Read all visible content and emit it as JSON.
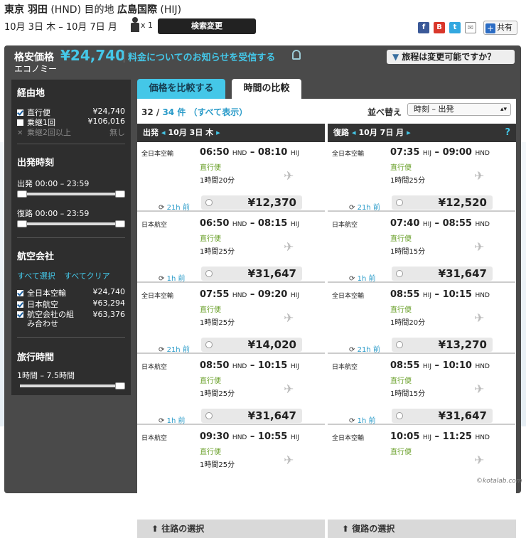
{
  "header": {
    "origin": "東京 羽田",
    "origin_code": "(HND)",
    "dest_label": "目的地",
    "dest": "広島国際",
    "dest_code": "(HIJ)",
    "dates": "10月 3日 木 – 10月 7日 月",
    "passengers": "x 1",
    "search_change": "検索変更",
    "share_label": "共有"
  },
  "price_bar": {
    "label": "格安価格",
    "price": "¥24,740",
    "notify": "料金についてのお知らせを受信する",
    "cabin": "エコノミー",
    "change_question": "旅程は変更可能ですか？"
  },
  "sidebar": {
    "stops_title": "経由地",
    "stops": [
      {
        "label": "直行便",
        "price": "¥24,740",
        "checked": true
      },
      {
        "label": "乗継1回",
        "price": "¥106,016",
        "checked": false
      },
      {
        "label": "乗継2回以上",
        "price": "無し",
        "disabled": true
      }
    ],
    "depart_title": "出発時刻",
    "outbound_range": "出発 00:00 – 23:59",
    "return_range": "復路 00:00 – 23:59",
    "airline_title": "航空会社",
    "select_all": "すべて選択",
    "clear_all": "すべてクリア",
    "airlines": [
      {
        "label": "全日本空輸",
        "price": "¥24,740"
      },
      {
        "label": "日本航空",
        "price": "¥63,294"
      },
      {
        "label": "航空会社の組み合わせ",
        "price": "¥63,376"
      }
    ],
    "duration_title": "旅行時間",
    "duration_range": "1時間 – 7.5時間"
  },
  "tabs": {
    "compare_price": "価格を比較する",
    "compare_time": "時間の比較"
  },
  "results": {
    "shown": "32 /",
    "total": "34 件 （すべて表示）",
    "sort_label": "並べ替え",
    "sort_value": "時刻 – 出発"
  },
  "outbound": {
    "title": "出発",
    "date": "10月 3日 木",
    "footer": "往路の選択",
    "flights": [
      {
        "airline": "全日本空輸",
        "dep": "06:50",
        "dep_code": "HND",
        "arr": "08:10",
        "arr_code": "HIJ",
        "stops": "直行便",
        "duration": "1時間20分",
        "price": "¥12,370",
        "age": "21h 前"
      },
      {
        "airline": "日本航空",
        "dep": "06:50",
        "dep_code": "HND",
        "arr": "08:15",
        "arr_code": "HIJ",
        "stops": "直行便",
        "duration": "1時間25分",
        "price": "¥31,647",
        "age": "1h 前"
      },
      {
        "airline": "全日本空輸",
        "dep": "07:55",
        "dep_code": "HND",
        "arr": "09:20",
        "arr_code": "HIJ",
        "stops": "直行便",
        "duration": "1時間25分",
        "price": "¥14,020",
        "age": "21h 前"
      },
      {
        "airline": "日本航空",
        "dep": "08:50",
        "dep_code": "HND",
        "arr": "10:15",
        "arr_code": "HIJ",
        "stops": "直行便",
        "duration": "1時間25分",
        "price": "¥31,647",
        "age": "1h 前"
      },
      {
        "airline": "日本航空",
        "dep": "09:30",
        "dep_code": "HND",
        "arr": "10:55",
        "arr_code": "HIJ",
        "stops": "直行便",
        "duration": "1時間25分",
        "price": "",
        "age": ""
      }
    ]
  },
  "inbound": {
    "title": "復路",
    "date": "10月 7日 月",
    "footer": "復路の選択",
    "flights": [
      {
        "airline": "全日本空輸",
        "dep": "07:35",
        "dep_code": "HIJ",
        "arr": "09:00",
        "arr_code": "HND",
        "stops": "直行便",
        "duration": "1時間25分",
        "price": "¥12,520",
        "age": "21h 前"
      },
      {
        "airline": "日本航空",
        "dep": "07:40",
        "dep_code": "HIJ",
        "arr": "08:55",
        "arr_code": "HND",
        "stops": "直行便",
        "duration": "1時間15分",
        "price": "¥31,647",
        "age": "1h 前"
      },
      {
        "airline": "全日本空輸",
        "dep": "08:55",
        "dep_code": "HIJ",
        "arr": "10:15",
        "arr_code": "HND",
        "stops": "直行便",
        "duration": "1時間20分",
        "price": "¥13,270",
        "age": "21h 前"
      },
      {
        "airline": "日本航空",
        "dep": "08:55",
        "dep_code": "HIJ",
        "arr": "10:10",
        "arr_code": "HND",
        "stops": "直行便",
        "duration": "1時間15分",
        "price": "¥31,647",
        "age": "1h 前"
      },
      {
        "airline": "全日本空輸",
        "dep": "10:05",
        "dep_code": "HIJ",
        "arr": "11:25",
        "arr_code": "HND",
        "stops": "直行便",
        "duration": "",
        "price": "",
        "age": ""
      }
    ]
  },
  "watermark": "©kotalab.com"
}
